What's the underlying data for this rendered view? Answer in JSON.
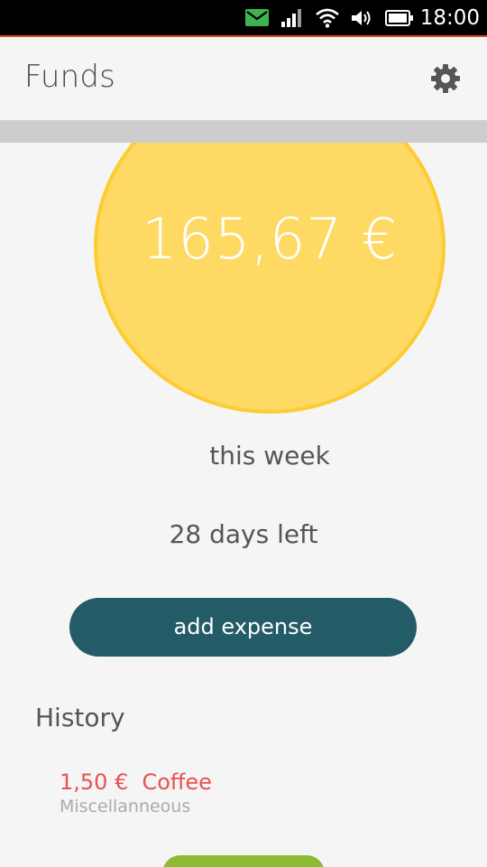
{
  "status_bar": {
    "time": "18:00",
    "icons": [
      "message-icon",
      "signal-icon",
      "wifi-icon",
      "volume-icon",
      "battery-icon"
    ],
    "message_color": "#3eb34f"
  },
  "header": {
    "title": "Funds",
    "settings_icon": "gear-icon"
  },
  "budget": {
    "amount": "165,67 €",
    "period": "this week",
    "days_left": "28 days left",
    "circle_color": "#fed964",
    "circle_border_color": "#fccc32"
  },
  "actions": {
    "add_expense_label": "add expense",
    "button_color": "#235b67",
    "secondary_button_color": "#8cbc32"
  },
  "history": {
    "title": "History",
    "items": [
      {
        "amount": "1,50 €",
        "name": "Coffee",
        "category": "Miscellanneous",
        "color": "#e8524f"
      }
    ]
  }
}
